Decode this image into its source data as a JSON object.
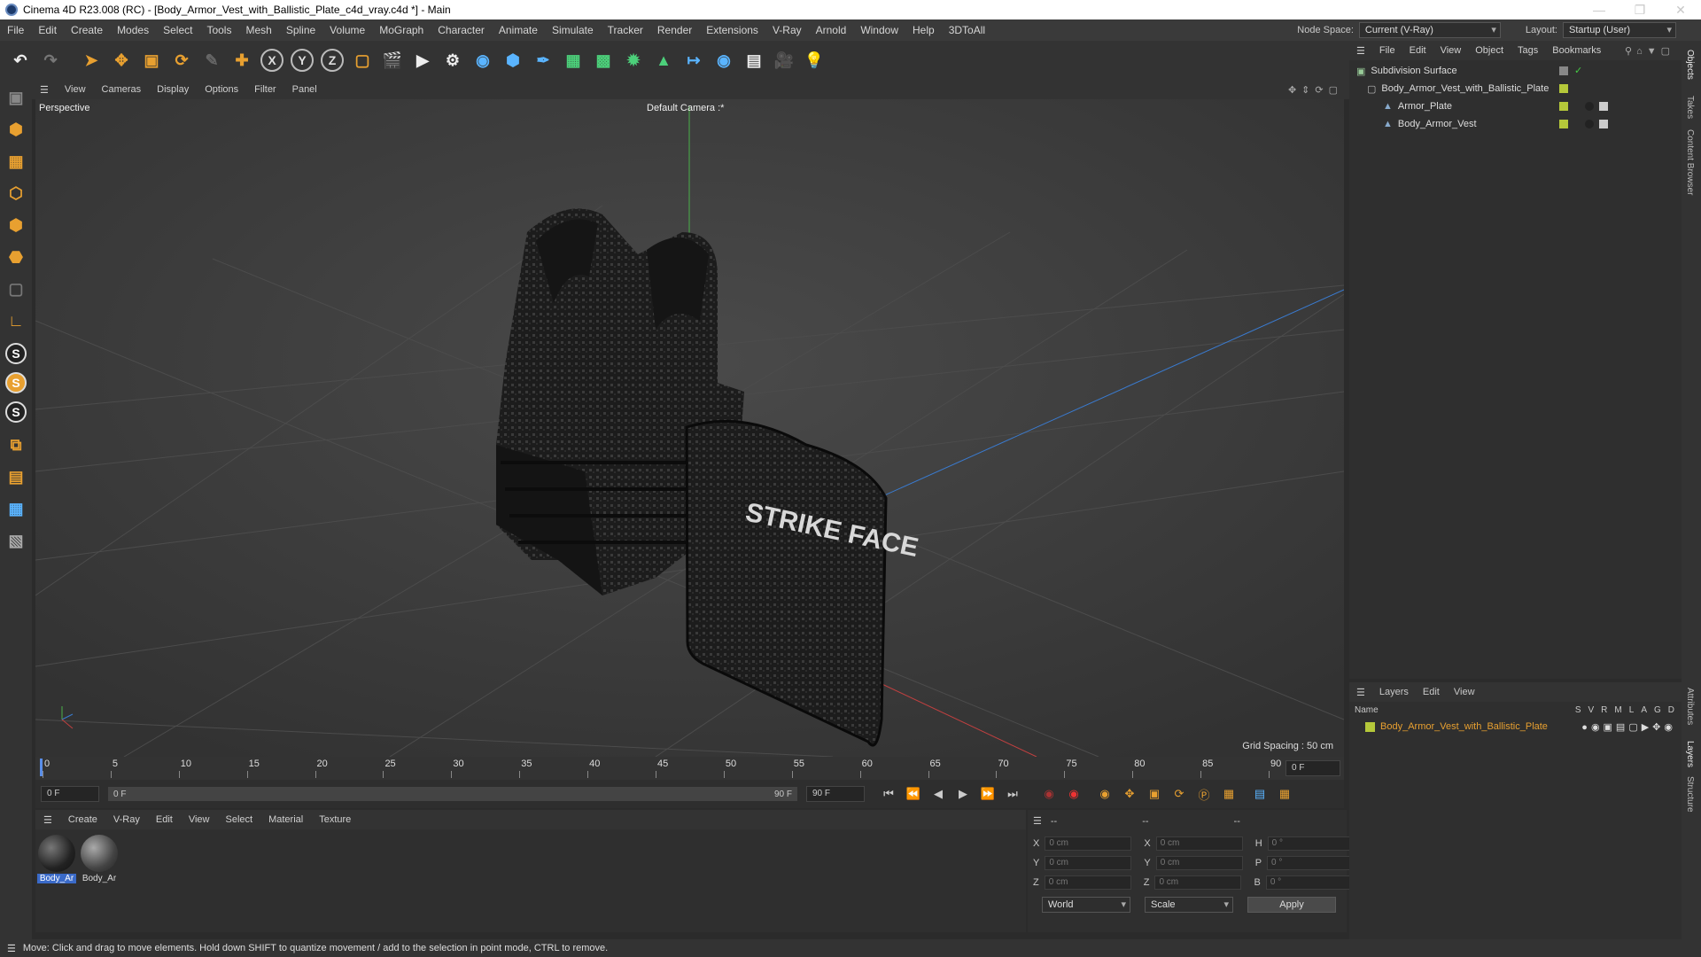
{
  "titlebar": {
    "title": "Cinema 4D R23.008 (RC) - [Body_Armor_Vest_with_Ballistic_Plate_c4d_vray.c4d *] - Main"
  },
  "menubar": {
    "items": [
      "File",
      "Edit",
      "Create",
      "Modes",
      "Select",
      "Tools",
      "Mesh",
      "Spline",
      "Volume",
      "MoGraph",
      "Character",
      "Animate",
      "Simulate",
      "Tracker",
      "Render",
      "Extensions",
      "V-Ray",
      "Arnold",
      "Window",
      "Help",
      "3DToAll"
    ],
    "node_space_label": "Node Space:",
    "node_space_value": "Current (V-Ray)",
    "layout_label": "Layout:",
    "layout_value": "Startup (User)"
  },
  "viewport": {
    "menu": [
      "View",
      "Cameras",
      "Display",
      "Options",
      "Filter",
      "Panel"
    ],
    "view_name": "Perspective",
    "camera": "Default Camera :*",
    "grid_spacing": "Grid Spacing : 50 cm",
    "plate_text": "STRIKE FACE"
  },
  "timeline": {
    "ticks": [
      "0",
      "5",
      "10",
      "15",
      "20",
      "25",
      "30",
      "35",
      "40",
      "45",
      "50",
      "55",
      "60",
      "65",
      "70",
      "75",
      "80",
      "85",
      "90"
    ],
    "current_frame_right": "0 F",
    "start": "0 F",
    "range_start": "0 F",
    "range_end": "90 F",
    "end": "90 F"
  },
  "materials": {
    "menu": [
      "Create",
      "V-Ray",
      "Edit",
      "View",
      "Select",
      "Material",
      "Texture"
    ],
    "items": [
      "Body_Ar",
      "Body_Ar"
    ]
  },
  "coords": {
    "header1": "--",
    "header2": "--",
    "header3": "--",
    "rows": [
      {
        "a": "X",
        "av": "0 cm",
        "b": "X",
        "bv": "0 cm",
        "c": "H",
        "cv": "0 °"
      },
      {
        "a": "Y",
        "av": "0 cm",
        "b": "Y",
        "bv": "0 cm",
        "c": "P",
        "cv": "0 °"
      },
      {
        "a": "Z",
        "av": "0 cm",
        "b": "Z",
        "bv": "0 cm",
        "c": "B",
        "cv": "0 °"
      }
    ],
    "space": "World",
    "mode": "Scale",
    "apply": "Apply"
  },
  "objects": {
    "menu": [
      "File",
      "Edit",
      "View",
      "Object",
      "Tags",
      "Bookmarks"
    ],
    "tree": [
      {
        "name": "Subdivision Surface",
        "level": 0
      },
      {
        "name": "Body_Armor_Vest_with_Ballistic_Plate",
        "level": 1
      },
      {
        "name": "Armor_Plate",
        "level": 2
      },
      {
        "name": "Body_Armor_Vest",
        "level": 2
      }
    ]
  },
  "layers": {
    "menu": [
      "Layers",
      "Edit",
      "View"
    ],
    "col_name": "Name",
    "cols": [
      "S",
      "V",
      "R",
      "M",
      "L",
      "A",
      "G",
      "D"
    ],
    "rows": [
      {
        "name": "Body_Armor_Vest_with_Ballistic_Plate",
        "color": "#b5c83a"
      }
    ]
  },
  "right_tabs": [
    "Objects",
    "Takes",
    "Content Browser",
    "Attributes",
    "Layers",
    "Structure"
  ],
  "status": "Move: Click and drag to move elements. Hold down SHIFT to quantize movement / add to the selection in point mode, CTRL to remove.",
  "colors": {
    "accent": "#e8a030",
    "layer_green": "#b5c83a",
    "selection": "#3a6ac8"
  }
}
